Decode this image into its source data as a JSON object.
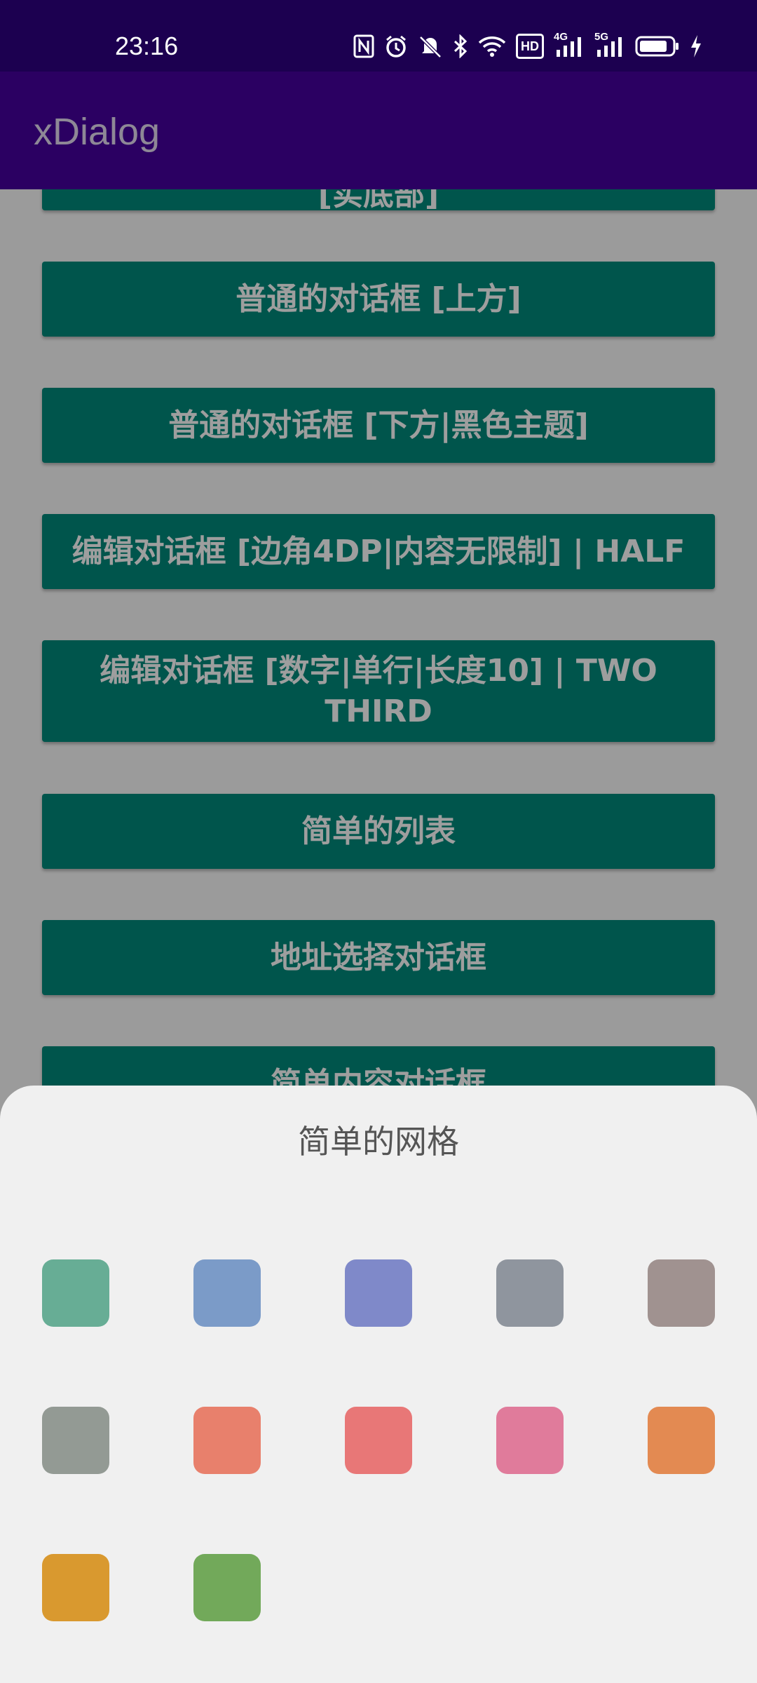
{
  "status_bar": {
    "time": "23:16",
    "icons": [
      "nfc-icon",
      "alarm-icon",
      "mute-icon",
      "bluetooth-icon",
      "wifi-icon",
      "hd-icon",
      "signal-4g-icon",
      "signal-5g-icon",
      "battery-icon",
      "charging-icon"
    ],
    "hd_label": "HD",
    "net1_label": "4G",
    "net2_label": "5G"
  },
  "app_bar": {
    "title": "xDialog"
  },
  "buttons": [
    {
      "label": "[实底部]"
    },
    {
      "label": "普通的对话框 [上方]"
    },
    {
      "label": "普通的对话框 [下方|黑色主题]"
    },
    {
      "label": "编辑对话框 [边角4DP|内容无限制] | HALF"
    },
    {
      "label": "编辑对话框 [数字|单行|长度10] | TWO THIRD"
    },
    {
      "label": "简单的列表"
    },
    {
      "label": "地址选择对话框"
    },
    {
      "label": "简单内容对话框"
    }
  ],
  "sheet": {
    "title": "简单的网格",
    "items": [
      {
        "color": "#67ad95",
        "icon": "grid-color-tile-icon"
      },
      {
        "color": "#7b9bc8",
        "icon": "grid-color-tile-icon"
      },
      {
        "color": "#7f89c9",
        "icon": "grid-color-tile-icon"
      },
      {
        "color": "#8f959e",
        "icon": "grid-color-tile-icon"
      },
      {
        "color": "#a09290",
        "icon": "grid-color-tile-icon"
      },
      {
        "color": "#939a94",
        "icon": "grid-color-tile-icon"
      },
      {
        "color": "#e8806c",
        "icon": "grid-color-tile-icon"
      },
      {
        "color": "#e87777",
        "icon": "grid-color-tile-icon"
      },
      {
        "color": "#e07b9b",
        "icon": "grid-color-tile-icon"
      },
      {
        "color": "#e38a52",
        "icon": "grid-color-tile-icon"
      },
      {
        "color": "#d9992f",
        "icon": "grid-color-tile-icon"
      },
      {
        "color": "#72a95a",
        "icon": "grid-color-tile-icon"
      }
    ]
  },
  "colors": {
    "status_bar_bg": "#1c0050",
    "app_bar_bg": "#2b0062",
    "button_bg": "#00897b",
    "sheet_bg": "#f0f0f0"
  }
}
